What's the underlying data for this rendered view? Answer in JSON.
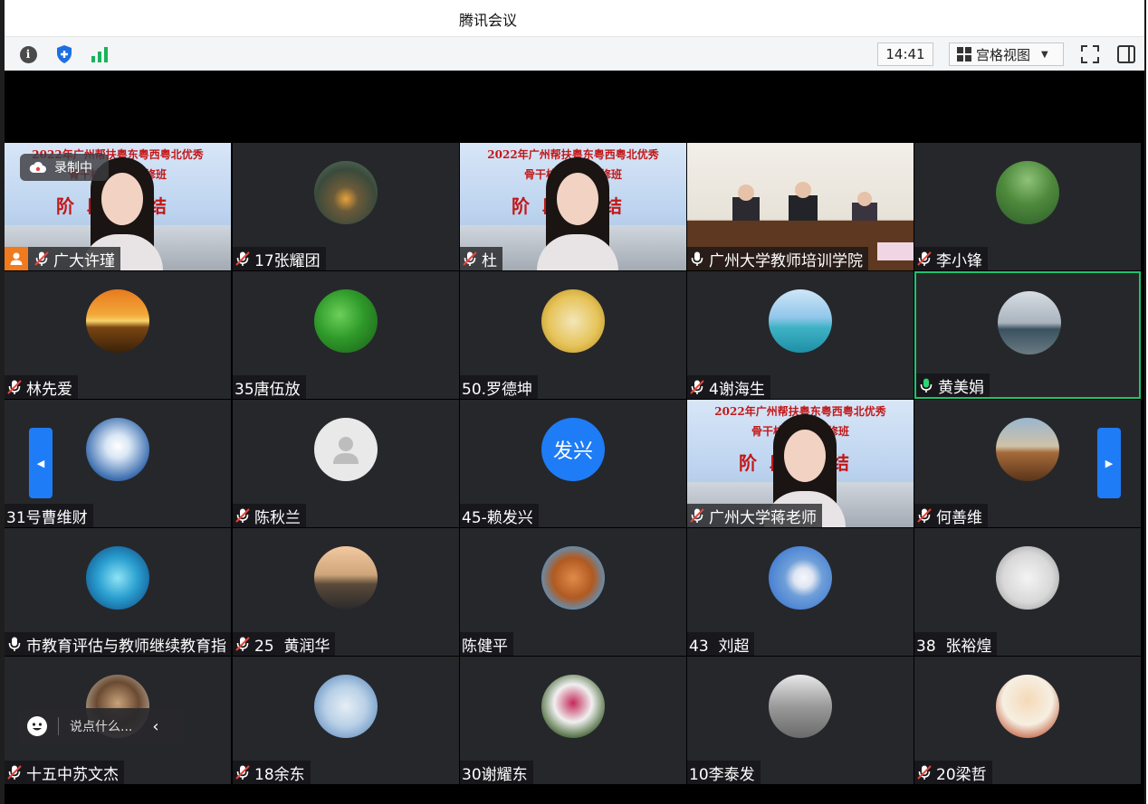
{
  "app": {
    "title": "腾讯会议"
  },
  "toolbar": {
    "time": "14:41",
    "view_label": "宫格视图",
    "icons": [
      "info-icon",
      "shield-icon",
      "signal-icon",
      "fullscreen-icon",
      "panel-icon"
    ]
  },
  "recording": {
    "label": "录制中"
  },
  "banner": {
    "line1": "2022年广州帮扶粤东粤西粤北优秀",
    "line2": "骨干校长高端研修班",
    "line3": "阶段总结"
  },
  "chat": {
    "placeholder": "说点什么..."
  },
  "colors": {
    "active_border": "#1ec46b",
    "accent": "#1e7cf7",
    "tile_bg": "#26272b"
  },
  "participants": [
    {
      "name": "广大许瑾",
      "mic": "muted",
      "kind": "video-banner",
      "host_badge": true
    },
    {
      "name": "17张耀团",
      "mic": "muted",
      "kind": "avatar",
      "avatar": "campfire"
    },
    {
      "name": "杜",
      "mic": "muted",
      "kind": "video-banner"
    },
    {
      "name": "广州大学教师培训学院",
      "mic": "on",
      "kind": "video-room"
    },
    {
      "name": "李小锋",
      "mic": "muted",
      "kind": "avatar",
      "avatar": "garden"
    },
    {
      "name": "林先爱",
      "mic": "muted",
      "kind": "avatar",
      "avatar": "sunset"
    },
    {
      "name": "35唐伍放",
      "mic": "none",
      "kind": "avatar",
      "avatar": "leaves"
    },
    {
      "name": "50.罗德坤",
      "mic": "none",
      "kind": "avatar",
      "avatar": "calligraphy"
    },
    {
      "name": "4谢海生",
      "mic": "muted",
      "kind": "avatar",
      "avatar": "sea"
    },
    {
      "name": "黄美娟",
      "mic": "active",
      "kind": "avatar",
      "avatar": "beach",
      "active": true
    },
    {
      "name": "31号曹维财",
      "mic": "none",
      "kind": "avatar",
      "avatar": "cloud"
    },
    {
      "name": "陈秋兰",
      "mic": "muted",
      "kind": "avatar",
      "avatar": "default-user"
    },
    {
      "name": "45-赖发兴",
      "mic": "none",
      "kind": "avatar",
      "avatar_text": "发兴"
    },
    {
      "name": "广州大学蒋老师",
      "mic": "muted",
      "kind": "video-banner"
    },
    {
      "name": "何善维",
      "mic": "muted",
      "kind": "avatar",
      "avatar": "field"
    },
    {
      "name": "市教育评估与教师继续教育指",
      "mic": "on",
      "kind": "avatar",
      "avatar": "jellyfish"
    },
    {
      "name": "25  黄润华",
      "mic": "muted",
      "kind": "avatar",
      "avatar": "lake-sunset"
    },
    {
      "name": "陈健平",
      "mic": "none",
      "kind": "avatar",
      "avatar": "basketball"
    },
    {
      "name": "43  刘超",
      "mic": "none",
      "kind": "avatar",
      "avatar": "moon"
    },
    {
      "name": "38  张裕煌",
      "mic": "none",
      "kind": "avatar",
      "avatar": "ink-painting"
    },
    {
      "name": "十五中苏文杰",
      "mic": "muted",
      "kind": "avatar",
      "avatar": "man-portrait"
    },
    {
      "name": "18余东",
      "mic": "muted",
      "kind": "avatar",
      "avatar": "illustration"
    },
    {
      "name": "30谢耀东",
      "mic": "none",
      "kind": "avatar",
      "avatar": "flowers"
    },
    {
      "name": "10李泰发",
      "mic": "none",
      "kind": "avatar",
      "avatar": "building"
    },
    {
      "name": "20梁哲",
      "mic": "muted",
      "kind": "avatar",
      "avatar": "cartoon"
    }
  ]
}
